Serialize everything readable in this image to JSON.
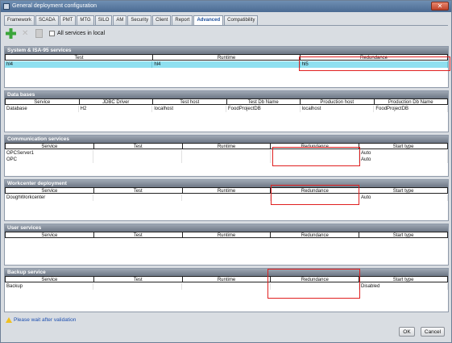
{
  "window": {
    "title": "General deployment configuration",
    "close_icon": "close-icon"
  },
  "tabs": [
    {
      "label": "Framework"
    },
    {
      "label": "SCADA"
    },
    {
      "label": "PMT"
    },
    {
      "label": "MTG"
    },
    {
      "label": "SILO"
    },
    {
      "label": "AM"
    },
    {
      "label": "Security"
    },
    {
      "label": "Client"
    },
    {
      "label": "Report"
    },
    {
      "label": "Advanced"
    },
    {
      "label": "Compatibility"
    }
  ],
  "active_tab": "Advanced",
  "toolbar": {
    "all_services_label": "All services in local",
    "all_services_checked": false
  },
  "sections": {
    "system": {
      "title": "System & ISA-95 services",
      "columns": [
        "Test",
        "Runtime",
        "Redundance"
      ],
      "rows": [
        [
          "hl4",
          "hl4",
          "hl5"
        ]
      ]
    },
    "databases": {
      "title": "Data bases",
      "columns": [
        "Service",
        "JDBC Driver",
        "Test host",
        "Test Db Name",
        "Production host",
        "Production Db Name"
      ],
      "rows": [
        [
          "Database",
          "H2",
          "localhost",
          "FoodProjectDB",
          "localhost",
          "FoodProjectDB"
        ]
      ]
    },
    "communication": {
      "title": "Communication services",
      "columns": [
        "Service",
        "Test",
        "Runtime",
        "Redundance",
        "Start type"
      ],
      "rows": [
        [
          "OPCServer1",
          "",
          "",
          "",
          "Auto"
        ],
        [
          "OPC",
          "",
          "",
          "",
          "Auto"
        ]
      ]
    },
    "workcenter": {
      "title": "Workcenter deployment",
      "columns": [
        "Service",
        "Test",
        "Runtime",
        "Redundance",
        "Start type"
      ],
      "rows": [
        [
          "DoughWorkcenter",
          "",
          "",
          "",
          "Auto"
        ]
      ]
    },
    "user": {
      "title": "User services",
      "columns": [
        "Service",
        "Test",
        "Runtime",
        "Redundance",
        "Start type"
      ],
      "rows": []
    },
    "backup": {
      "title": "Backup service",
      "columns": [
        "Service",
        "Test",
        "Runtime",
        "Redundance",
        "Start type"
      ],
      "rows": [
        [
          "Backup",
          "",
          "",
          "",
          "Disabled"
        ]
      ]
    }
  },
  "status": {
    "message": "Please wait after validation"
  },
  "buttons": {
    "ok": "OK",
    "cancel": "Cancel"
  },
  "colors": {
    "highlight_row": "#8fe0f0",
    "annotation_red": "#e02020",
    "active_tab_text": "#1d4f9c"
  }
}
